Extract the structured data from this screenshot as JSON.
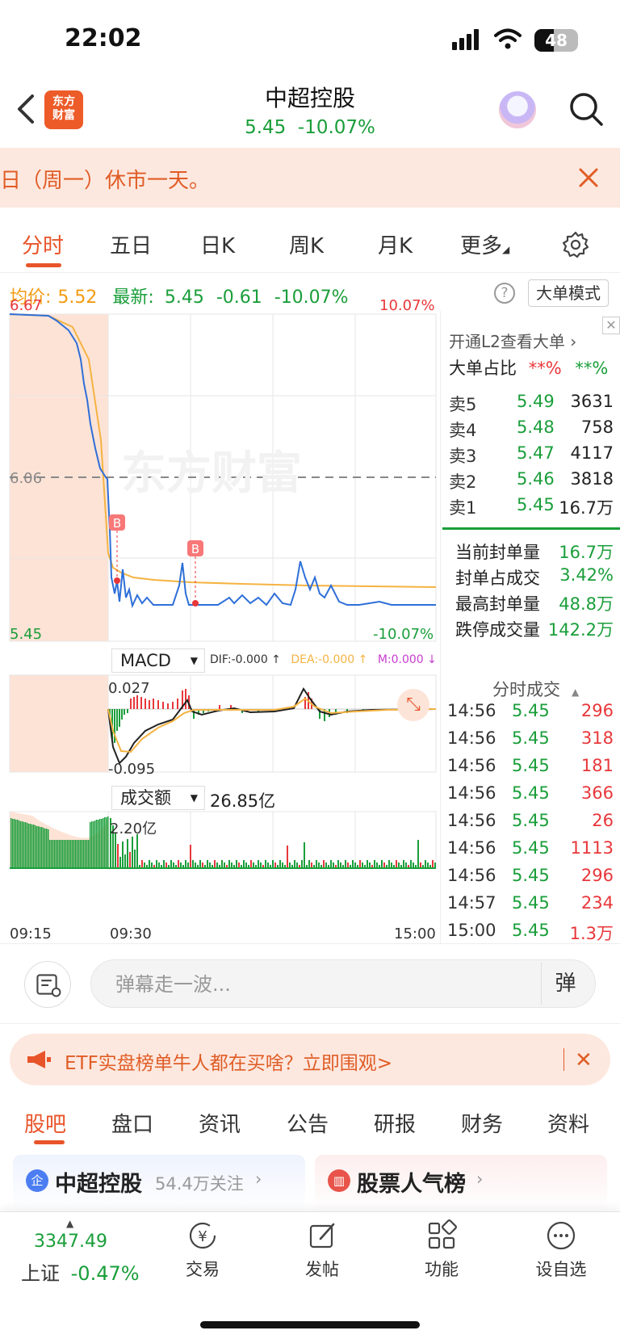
{
  "status_bar": {
    "time": "22:02",
    "battery": "48"
  },
  "header": {
    "title": "中超控股",
    "price": "5.45",
    "change_pct": "-10.07%",
    "quote_line": "5.45  -10.07%"
  },
  "notice": {
    "text": "日（周一）休市一天。"
  },
  "chart_tabs": [
    "分时",
    "五日",
    "日K",
    "周K",
    "月K",
    "更多"
  ],
  "info": {
    "avg_label": "均价:",
    "avg_value": "5.52",
    "latest_label": "最新:",
    "latest_value": "5.45",
    "change": "-0.61",
    "change_pct": "-10.07%",
    "mode_button": "大单模式"
  },
  "chart_data": {
    "type": "line",
    "y_max_label": "6.67",
    "y_mid_label": "6.06",
    "y_min_label": "5.45",
    "pct_top_label": "10.07%",
    "pct_bottom_label": "-10.07%",
    "x_labels": [
      "09:15",
      "09:30",
      "15:00"
    ],
    "watermark": "东方财富",
    "buy_markers": [
      "B",
      "B"
    ],
    "series": [
      {
        "name": "price",
        "values": [
          6.67,
          6.66,
          6.66,
          6.64,
          6.6,
          6.55,
          6.48,
          6.4,
          6.3,
          6.18,
          6.06,
          5.62,
          5.52,
          5.48,
          5.46,
          5.45,
          5.47,
          5.45,
          5.5,
          5.46,
          5.45,
          5.45,
          5.46,
          5.45,
          5.45,
          5.48,
          5.45,
          5.45,
          5.46,
          5.45
        ]
      },
      {
        "name": "avg",
        "values": [
          6.67,
          6.66,
          6.65,
          6.64,
          6.62,
          6.6,
          6.56,
          6.5,
          6.45,
          6.4,
          6.06,
          5.6,
          5.56,
          5.55,
          5.54,
          5.54,
          5.53,
          5.53,
          5.53,
          5.53,
          5.52,
          5.52,
          5.52,
          5.52,
          5.52,
          5.52,
          5.52,
          5.52,
          5.52,
          5.52
        ]
      }
    ],
    "macd": {
      "indicator": "MACD",
      "dif_label": "DIF:-0.000 ↑",
      "dea_label": "DEA:-0.000 ↑",
      "m_label": "M:0.000 ↓",
      "top_label": "0.027",
      "bottom_label": "-0.095"
    },
    "volume": {
      "indicator": "成交额",
      "total": "26.85亿",
      "max_label": "2.20亿"
    }
  },
  "l2_panel": {
    "link": "开通L2查看大单 ›",
    "ratio_label": "大单占比",
    "ratio_buy": "**%",
    "ratio_sell": "**%",
    "order_book": [
      {
        "label": "卖5",
        "price": "5.49",
        "volume": "3631"
      },
      {
        "label": "卖4",
        "price": "5.48",
        "volume": "758"
      },
      {
        "label": "卖3",
        "price": "5.47",
        "volume": "4117"
      },
      {
        "label": "卖2",
        "price": "5.46",
        "volume": "3818"
      },
      {
        "label": "卖1",
        "price": "5.45",
        "volume": "16.7万"
      }
    ],
    "seal": [
      {
        "label": "当前封单量",
        "value": "16.7万"
      },
      {
        "label": "封单占成交",
        "value": "3.42%"
      },
      {
        "label": "最高封单量",
        "value": "48.8万"
      },
      {
        "label": "跌停成交量",
        "value": "142.2万"
      }
    ],
    "ticks_title": "分时成交",
    "ticks": [
      {
        "time": "14:56",
        "price": "5.45",
        "vol": "296"
      },
      {
        "time": "14:56",
        "price": "5.45",
        "vol": "318"
      },
      {
        "time": "14:56",
        "price": "5.45",
        "vol": "181"
      },
      {
        "time": "14:56",
        "price": "5.45",
        "vol": "366"
      },
      {
        "time": "14:56",
        "price": "5.45",
        "vol": "26"
      },
      {
        "time": "14:56",
        "price": "5.45",
        "vol": "1113"
      },
      {
        "time": "14:56",
        "price": "5.45",
        "vol": "296"
      },
      {
        "time": "14:57",
        "price": "5.45",
        "vol": "234"
      },
      {
        "time": "15:00",
        "price": "5.45",
        "vol": "1.3万"
      }
    ]
  },
  "danmaku": {
    "placeholder": "弹幕走一波...",
    "toggle": "弹"
  },
  "ad": {
    "text": "ETF实盘榜单牛人都在买啥？立即围观>"
  },
  "bottom_tabs": [
    "股吧",
    "盘口",
    "资讯",
    "公告",
    "研报",
    "财务",
    "资料"
  ],
  "cards": {
    "stock": {
      "icon": "企",
      "title": "中超控股",
      "sub": "54.4万关注"
    },
    "rank": {
      "title": "股票人气榜"
    }
  },
  "bottom_nav": {
    "index_value": "3347.49",
    "index_name": "上证",
    "index_change": "-0.47%",
    "items": [
      "交易",
      "发帖",
      "功能",
      "设自选"
    ]
  },
  "colors": {
    "accent": "#e8542a",
    "down": "#1a9e3a",
    "up": "#e8373a",
    "avg_line": "#f5b342",
    "price_line": "#2e6fd8"
  }
}
